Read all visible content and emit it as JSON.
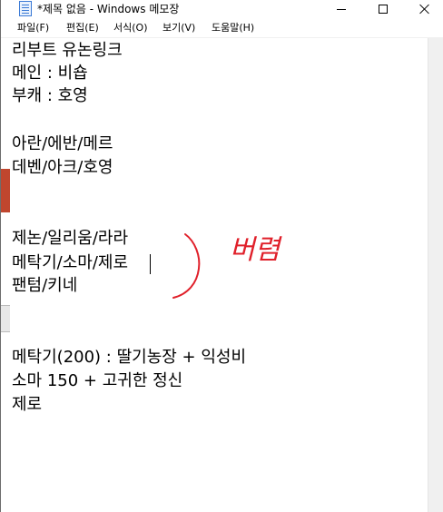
{
  "window": {
    "title": "*제목 없음 - Windows 메모장"
  },
  "menu": [
    "파일(F)",
    "편집(E)",
    "서식(O)",
    "보기(V)",
    "도움말(H)"
  ],
  "document": {
    "lines": [
      "리부트 유논링크",
      "메인 : 비숍",
      "부캐 : 호영",
      "아란/에반/메르",
      "데벤/아크/호영",
      "제논/일리움/라라",
      "메탁기/소마/제로",
      "팬텀/키네",
      "메탁기(200) : 딸기농장 + 익성비",
      "소마 150 + 고귀한 정신",
      "제로"
    ]
  },
  "annotation": {
    "handwritten_text": "버렴",
    "color": "#e0202a"
  },
  "colors": {
    "title_bar": "#ffffff",
    "editor_bg": "#ffffff",
    "text": "#000000",
    "annotation_red": "#e0202a"
  }
}
